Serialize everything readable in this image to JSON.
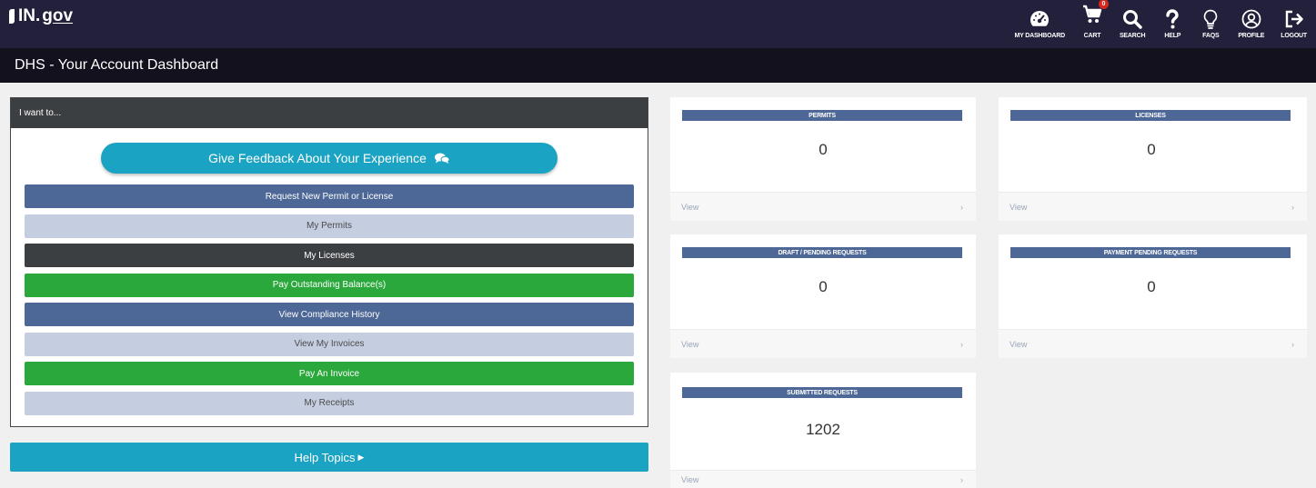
{
  "header": {
    "logo_text": "IN.",
    "logo_gov": "gov",
    "nav": [
      {
        "label": "MY DASHBOARD",
        "icon": "dashboard-icon"
      },
      {
        "label": "CART",
        "icon": "cart-icon",
        "badge": "0"
      },
      {
        "label": "SEARCH",
        "icon": "search-icon"
      },
      {
        "label": "HELP",
        "icon": "help-icon"
      },
      {
        "label": "FAQS",
        "icon": "lightbulb-icon"
      },
      {
        "label": "PROFILE",
        "icon": "profile-icon"
      },
      {
        "label": "LOGOUT",
        "icon": "logout-icon"
      }
    ]
  },
  "page_title": "DHS - Your Account Dashboard",
  "want": {
    "heading": "I want to...",
    "feedback_label": "Give Feedback About Your Experience",
    "actions": [
      {
        "label": "Request New Permit or License",
        "color": "#4d6796"
      },
      {
        "label": "My Permits",
        "color": "#c5cee0"
      },
      {
        "label": "My Licenses",
        "color": "#3c3f42"
      },
      {
        "label": "Pay Outstanding Balance(s)",
        "color": "#2ba83c"
      },
      {
        "label": "View Compliance History",
        "color": "#4d6796"
      },
      {
        "label": "View My Invoices",
        "color": "#c5cee0"
      },
      {
        "label": "Pay An Invoice",
        "color": "#2ba83c"
      },
      {
        "label": "My Receipts",
        "color": "#c5cee0"
      }
    ]
  },
  "help_topics_label": "Help Topics",
  "cards": [
    {
      "title": "PERMITS",
      "count": "0",
      "link": "View"
    },
    {
      "title": "LICENSES",
      "count": "0",
      "link": "View"
    },
    {
      "title": "DRAFT / PENDING REQUESTS",
      "count": "0",
      "link": "View"
    },
    {
      "title": "PAYMENT PENDING REQUESTS",
      "count": "0",
      "link": "View"
    },
    {
      "title": "SUBMITTED REQUESTS",
      "count": "1202",
      "link": "View"
    }
  ],
  "colors": {
    "topbar": "#22203a",
    "titlebar": "#12111d",
    "accent_teal": "#1aa3c3",
    "navy": "#4d6796",
    "green": "#2ba83c"
  }
}
